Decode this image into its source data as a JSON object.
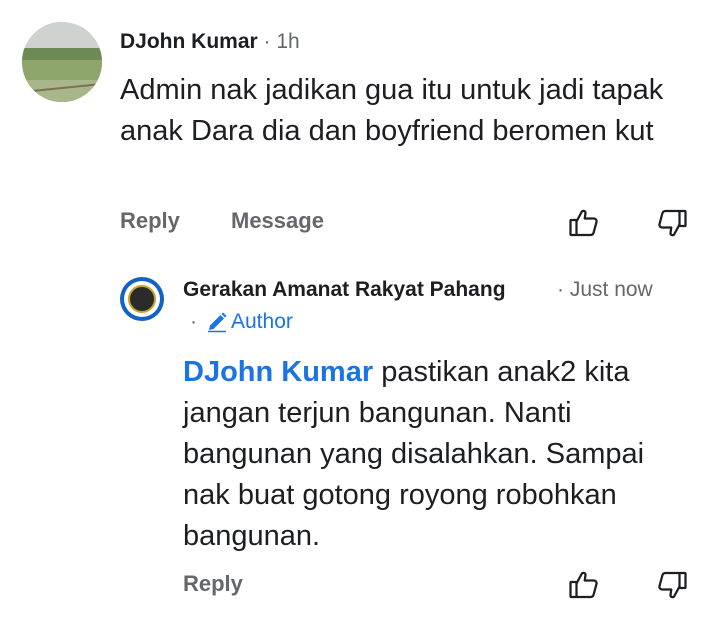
{
  "comment": {
    "author": "DJohn Kumar",
    "separator": "·",
    "time": "1h",
    "text": "Admin nak jadikan gua itu untuk jadi tapak anak Dara dia dan boyfriend beromen kut",
    "actions": {
      "reply": "Reply",
      "message": "Message"
    },
    "icons": [
      "like-icon",
      "dislike-icon"
    ]
  },
  "reply": {
    "author": "Gerakan Amanat Rakyat Pahang",
    "separator": "·",
    "time": "Just now",
    "badge": "Author",
    "mention": "DJohn Kumar",
    "text": " pastikan anak2 kita jangan terjun bangunan. Nanti bangunan yang disalahkan. Sampai nak buat gotong royong robohkan bangunan.",
    "actions": {
      "reply": "Reply"
    },
    "icons": [
      "like-icon",
      "dislike-icon",
      "pencil-icon"
    ]
  },
  "colors": {
    "link": "#1b74e4",
    "muted": "#65676b",
    "text": "#1c1e21"
  }
}
